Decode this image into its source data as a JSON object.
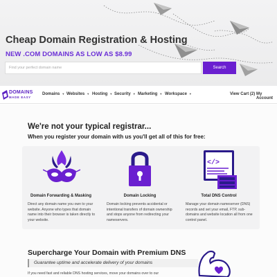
{
  "hero": {
    "title": "Cheap Domain Registration & Hosting",
    "subtitle": "NEW .COM DOMAINS AS LOW AS $8.99",
    "search_placeholder": "Find your perfect domain name",
    "search_button": "Search"
  },
  "nav": {
    "logo_line1": "DOMAINS",
    "logo_line2": "MADE EASY",
    "items": [
      "Domains",
      "Websites",
      "Hosting",
      "Security",
      "Marketing",
      "Workspace"
    ],
    "cart": "View Cart (2)",
    "account": "My Account"
  },
  "main": {
    "heading": "We're not your typical registrar...",
    "subheading": "When you register your domain with us you'll get all of this for free:",
    "features": [
      {
        "title": "Domain Forwarding & Masking",
        "desc": "Direct any domain name you own to your website. Anyone who types that domain name into their browser is taken directly to your website.",
        "icon": "mask-icon"
      },
      {
        "title": "Domain Locking",
        "desc": "Domain locking prevents accidental or intentional transfers of domain ownership and stops anyone from redirecting your nameservers.",
        "icon": "padlock-icon"
      },
      {
        "title": "Total DNS Control",
        "desc": "Manage your domain nameserver (DNS) records and set your email, FTP, sub-domains and website location all from one control panel.",
        "icon": "server-code-icon"
      }
    ],
    "dns_heading": "Supercharge Your Domain with Premium DNS",
    "dns_tagline": "Guarantee uptime and accelerate delivery of your domains",
    "dns_text": "If you need fast and reliable DNS hosting services, move your domains over to our"
  },
  "colors": {
    "accent": "#6a1fd0",
    "brand": "#5a1fc2"
  }
}
